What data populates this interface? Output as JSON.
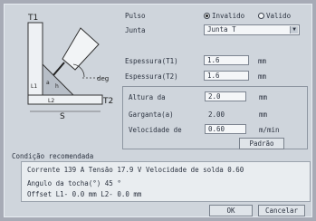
{
  "diagram": {
    "label_t1": "T1",
    "label_t2": "T2",
    "label_s": "S",
    "label_deg": "deg",
    "label_l1": "L1",
    "label_l2": "L2",
    "label_a": "a",
    "label_h": "h"
  },
  "pulse": {
    "label": "Pulso",
    "option_invalid": "Invalido",
    "option_valid": "Valido",
    "selected": "Invalido"
  },
  "junta": {
    "label": "Junta",
    "value": "Junta T"
  },
  "thickness1": {
    "label": "Espessura(T1)",
    "value": "1.6",
    "unit": "mm"
  },
  "thickness2": {
    "label": "Espessura(T2)",
    "value": "1.6",
    "unit": "mm"
  },
  "group": {
    "height_label": "Altura da",
    "height_value": "2.0",
    "height_unit": "mm",
    "throat_label": "Garganta(a)",
    "throat_value": "2.00",
    "throat_unit": "mm",
    "speed_label": "Velocidade de",
    "speed_value": "0.60",
    "speed_unit": "m/min",
    "default_button": "Padrão"
  },
  "recommendation": {
    "title": "Condição recomendada",
    "line1": "Corrente 139 A  Tensão 17.9 V Velocidade de solda  0.60",
    "line2": "Angulo da tocha(°)  45 °",
    "line3": "Offset  L1- 0.0 mm  L2- 0.0 mm"
  },
  "buttons": {
    "ok": "OK",
    "cancel": "Cancelar"
  }
}
